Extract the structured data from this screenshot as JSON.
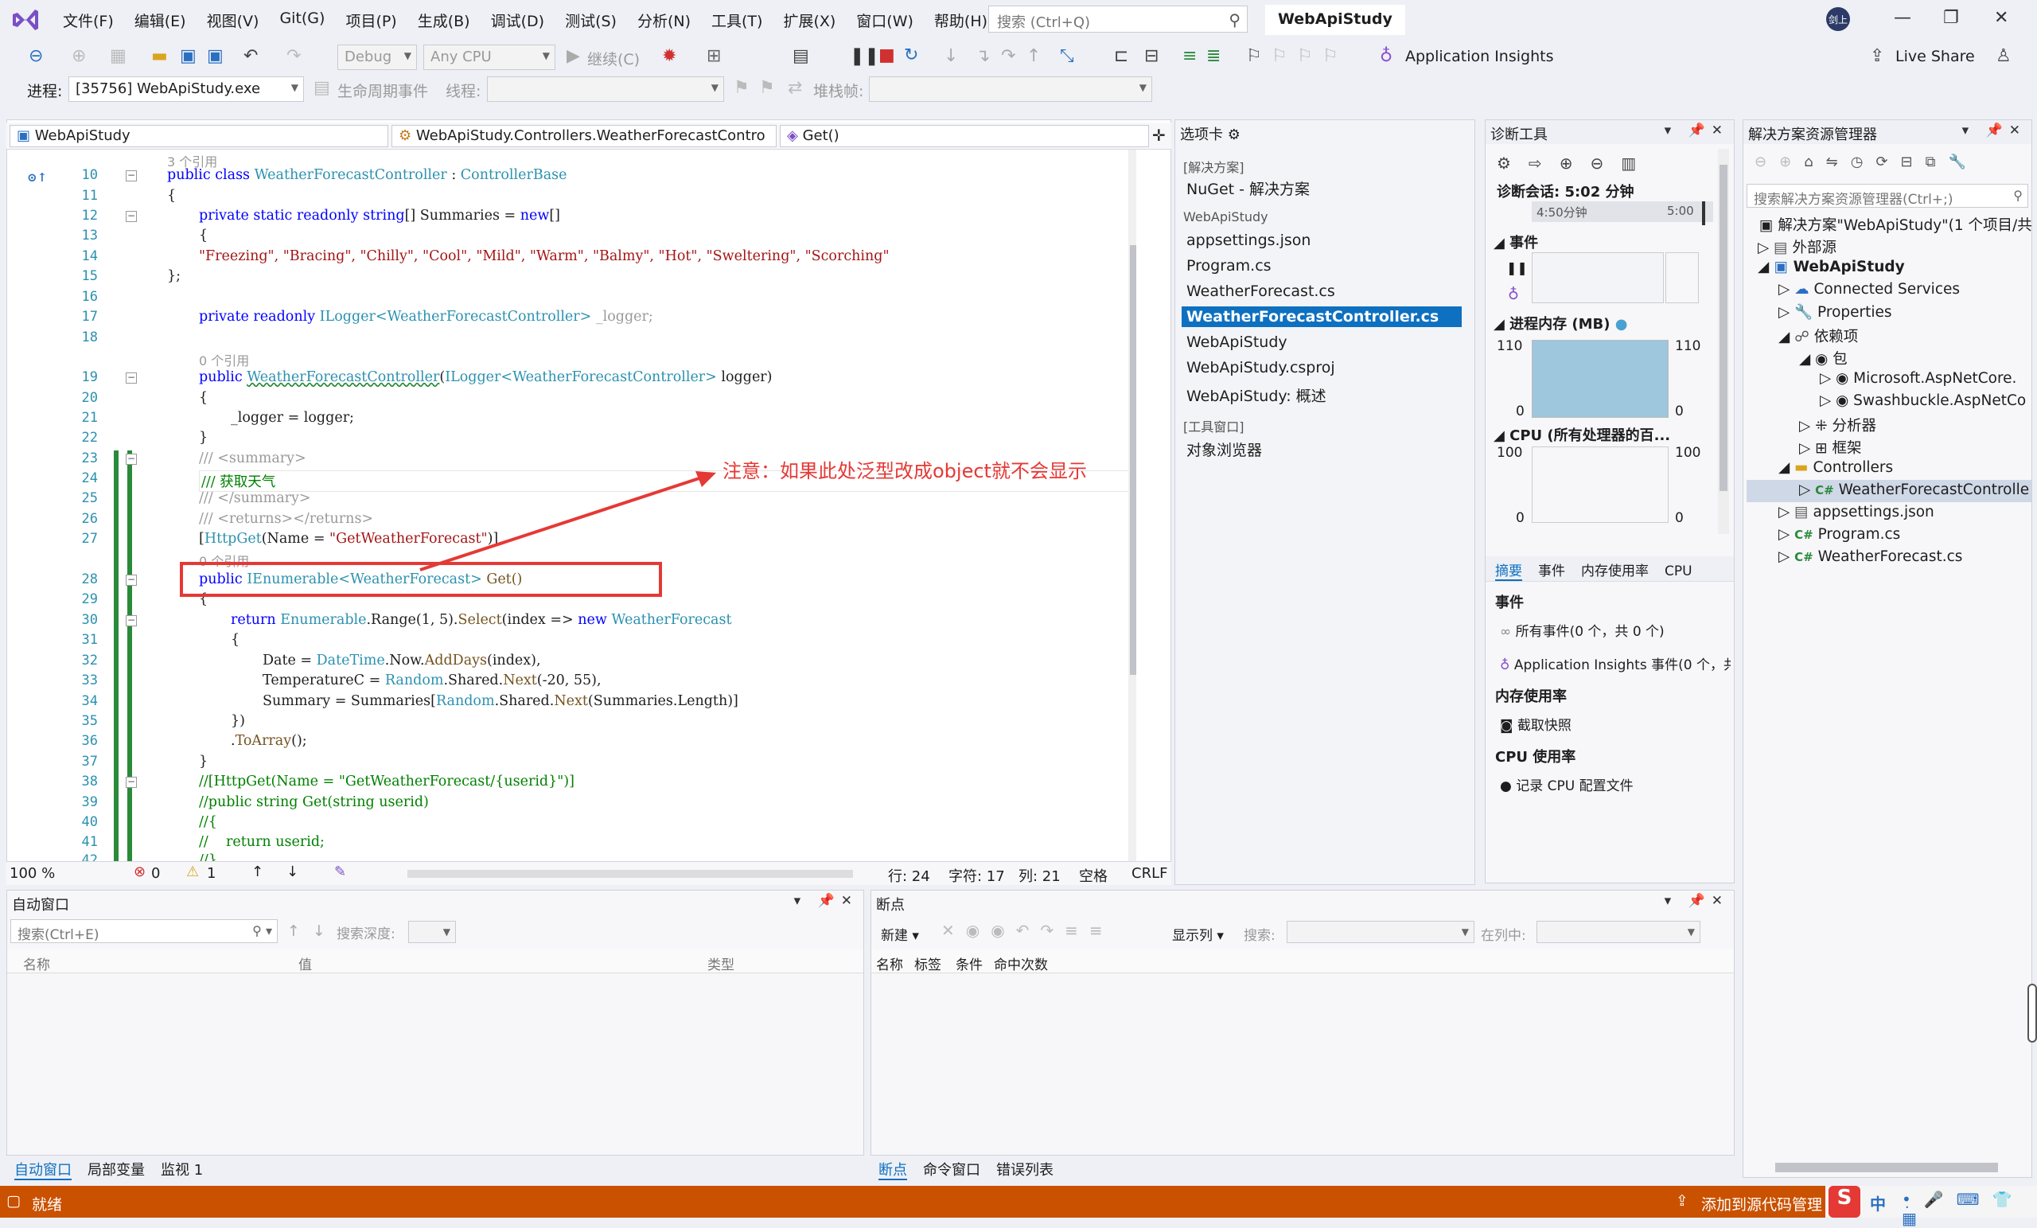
{
  "menubar": {
    "items": [
      "文件(F)",
      "编辑(E)",
      "视图(V)",
      "Git(G)",
      "项目(P)",
      "生成(B)",
      "调试(D)",
      "测试(S)",
      "分析(N)",
      "工具(T)",
      "扩展(X)",
      "窗口(W)",
      "帮助(H)"
    ],
    "search_placeholder": "搜索 (Ctrl+Q)",
    "solution_name": "WebApiStudy",
    "avatar": "剑上"
  },
  "toolbar": {
    "config": "Debug",
    "platform": "Any CPU",
    "continue": "继续(C)",
    "app_insights": "Application Insights",
    "live_share": "Live Share",
    "process_label": "进程:",
    "process": "[35756] WebApiStudy.exe",
    "lifecycle": "生命周期事件",
    "thread_label": "线程:",
    "stackframe_label": "堆栈帧:"
  },
  "editor": {
    "nav_project": "WebApiStudy",
    "nav_class": "WebApiStudy.Controllers.WeatherForecastContro",
    "nav_member": "Get()",
    "zoom": "100 %",
    "errors": "0",
    "warnings": "1",
    "line": "行: 24",
    "char": "字符: 17",
    "col": "列: 21",
    "spaces": "空格",
    "eol": "CRLF",
    "annotation": "注意：如果此处泛型改成object就不会显示"
  },
  "code": {
    "ref3": "3 个引用",
    "ref0": "0 个引用",
    "ref0b": "0 个引用",
    "l10a": "public",
    "l10b": "class",
    "l10c": "WeatherForecastController",
    "l10d": " : ",
    "l10e": "ControllerBase",
    "l11": "{",
    "l12a": "private static readonly",
    "l12b": "string",
    "l12c": "[] Summaries = ",
    "l12d": "new",
    "l12e": "[]",
    "l13": "{",
    "l14": "\"Freezing\", \"Bracing\", \"Chilly\", \"Cool\", \"Mild\", \"Warm\", \"Balmy\", \"Hot\", \"Sweltering\", \"Scorching\"",
    "l15": "};",
    "l17a": "private readonly",
    "l17b": "ILogger<WeatherForecastController>",
    "l17c": " _logger;",
    "l19a": "public",
    "l19b": "WeatherForecastController",
    "l19c": "(",
    "l19d": "ILogger<WeatherForecastController>",
    "l19e": " logger)",
    "l20": "{",
    "l21": "_logger = logger;",
    "l22": "}",
    "l23": "/// <summary>",
    "l24": "/// 获取天气",
    "l25": "/// </summary>",
    "l26": "/// <returns></returns>",
    "l27a": "[",
    "l27b": "HttpGet",
    "l27c": "(Name = ",
    "l27d": "\"GetWeatherForecast\"",
    "l27e": ")]",
    "l28a": "public",
    "l28b": "IEnumerable<WeatherForecast>",
    "l28c": " Get()",
    "l29": "{",
    "l30a": "return",
    "l30b": "Enumerable",
    "l30c": ".Range(1, 5).",
    "l30d": "Select",
    "l30e": "(index => ",
    "l30f": "new",
    "l30g": "WeatherForecast",
    "l31": "{",
    "l32a": "Date = ",
    "l32b": "DateTime",
    "l32c": ".Now.",
    "l32d": "AddDays",
    "l32e": "(index),",
    "l33a": "TemperatureC = ",
    "l33b": "Random",
    "l33c": ".Shared.",
    "l33d": "Next",
    "l33e": "(-20, 55),",
    "l34a": "Summary = Summaries[",
    "l34b": "Random",
    "l34c": ".Shared.",
    "l34d": "Next",
    "l34e": "(Summaries.Length)]",
    "l35": "})",
    "l36a": ".",
    "l36b": "ToArray",
    "l36c": "();",
    "l37": "}",
    "l38": "//[HttpGet(Name = \"GetWeatherForecast/{userid}\")]",
    "l39": "//public string Get(string userid)",
    "l40": "//{",
    "l41": "//    return userid;",
    "l42": "//}"
  },
  "line_numbers": [
    "10",
    "11",
    "12",
    "13",
    "14",
    "15",
    "16",
    "17",
    "18",
    "19",
    "20",
    "21",
    "22",
    "23",
    "24",
    "25",
    "26",
    "27",
    "28",
    "29",
    "30",
    "31",
    "32",
    "33",
    "34",
    "35",
    "36",
    "37",
    "38",
    "39",
    "40",
    "41",
    "42"
  ],
  "toolbox": {
    "title": "选项卡",
    "sec_solution": "[解决方案]",
    "nuget": "NuGet - 解决方案",
    "sec_project": "WebApiStudy",
    "files": [
      "appsettings.json",
      "Program.cs",
      "WeatherForecast.cs",
      "WeatherForecastController.cs",
      "WebApiStudy",
      "WebApiStudy.csproj",
      "WebApiStudy: 概述"
    ],
    "sec_tools": "[工具窗口]",
    "object_browser": "对象浏览器"
  },
  "diag": {
    "title": "诊断工具",
    "session": "诊断会话: 5:02 分钟",
    "t1": "4:50分钟",
    "t2": "5:00",
    "events": "事件",
    "memory": "进程内存 (MB)",
    "mem_max": "110",
    "mem_min": "0",
    "cpu": "CPU (所有处理器的百...",
    "cpu_max": "100",
    "cpu_min": "0",
    "tabs": [
      "摘要",
      "事件",
      "内存使用率",
      "CPU"
    ],
    "h_events": "事件",
    "all_events": "所有事件(0 个，共 0 个)",
    "ai_events": "Application Insights 事件(0 个，共",
    "h_memory": "内存使用率",
    "snapshot": "截取快照",
    "h_cpu": "CPU 使用率",
    "record_cpu": "记录 CPU 配置文件"
  },
  "solution": {
    "title": "解决方案资源管理器",
    "search": "搜索解决方案资源管理器(Ctrl+;)",
    "root": "解决方案\"WebApiStudy\"(1 个项目/共",
    "external": "外部源",
    "project": "WebApiStudy",
    "connected": "Connected Services",
    "properties": "Properties",
    "deps": "依赖项",
    "pkg": "包",
    "pkg1": "Microsoft.AspNetCore.",
    "pkg2": "Swashbuckle.AspNetCo",
    "analyzers": "分析器",
    "frameworks": "框架",
    "controllers": "Controllers",
    "ctrl_file": "WeatherForecastControlle",
    "appsettings": "appsettings.json",
    "program": "Program.cs",
    "wf": "WeatherForecast.cs"
  },
  "autos": {
    "title": "自动窗口",
    "search": "搜索(Ctrl+E)",
    "depth": "搜索深度:",
    "cols": [
      "名称",
      "值",
      "类型"
    ],
    "tabs": [
      "自动窗口",
      "局部变量",
      "监视 1"
    ]
  },
  "breakpoints": {
    "title": "断点",
    "new": "新建",
    "show_cols": "显示列",
    "search": "搜索:",
    "in_col": "在列中:",
    "cols": [
      "名称",
      "标签",
      "条件",
      "命中次数"
    ],
    "tabs": [
      "断点",
      "命令窗口",
      "错误列表"
    ]
  },
  "status": {
    "ready": "就绪",
    "source": "添加到源代码管理",
    "ime": "中"
  }
}
